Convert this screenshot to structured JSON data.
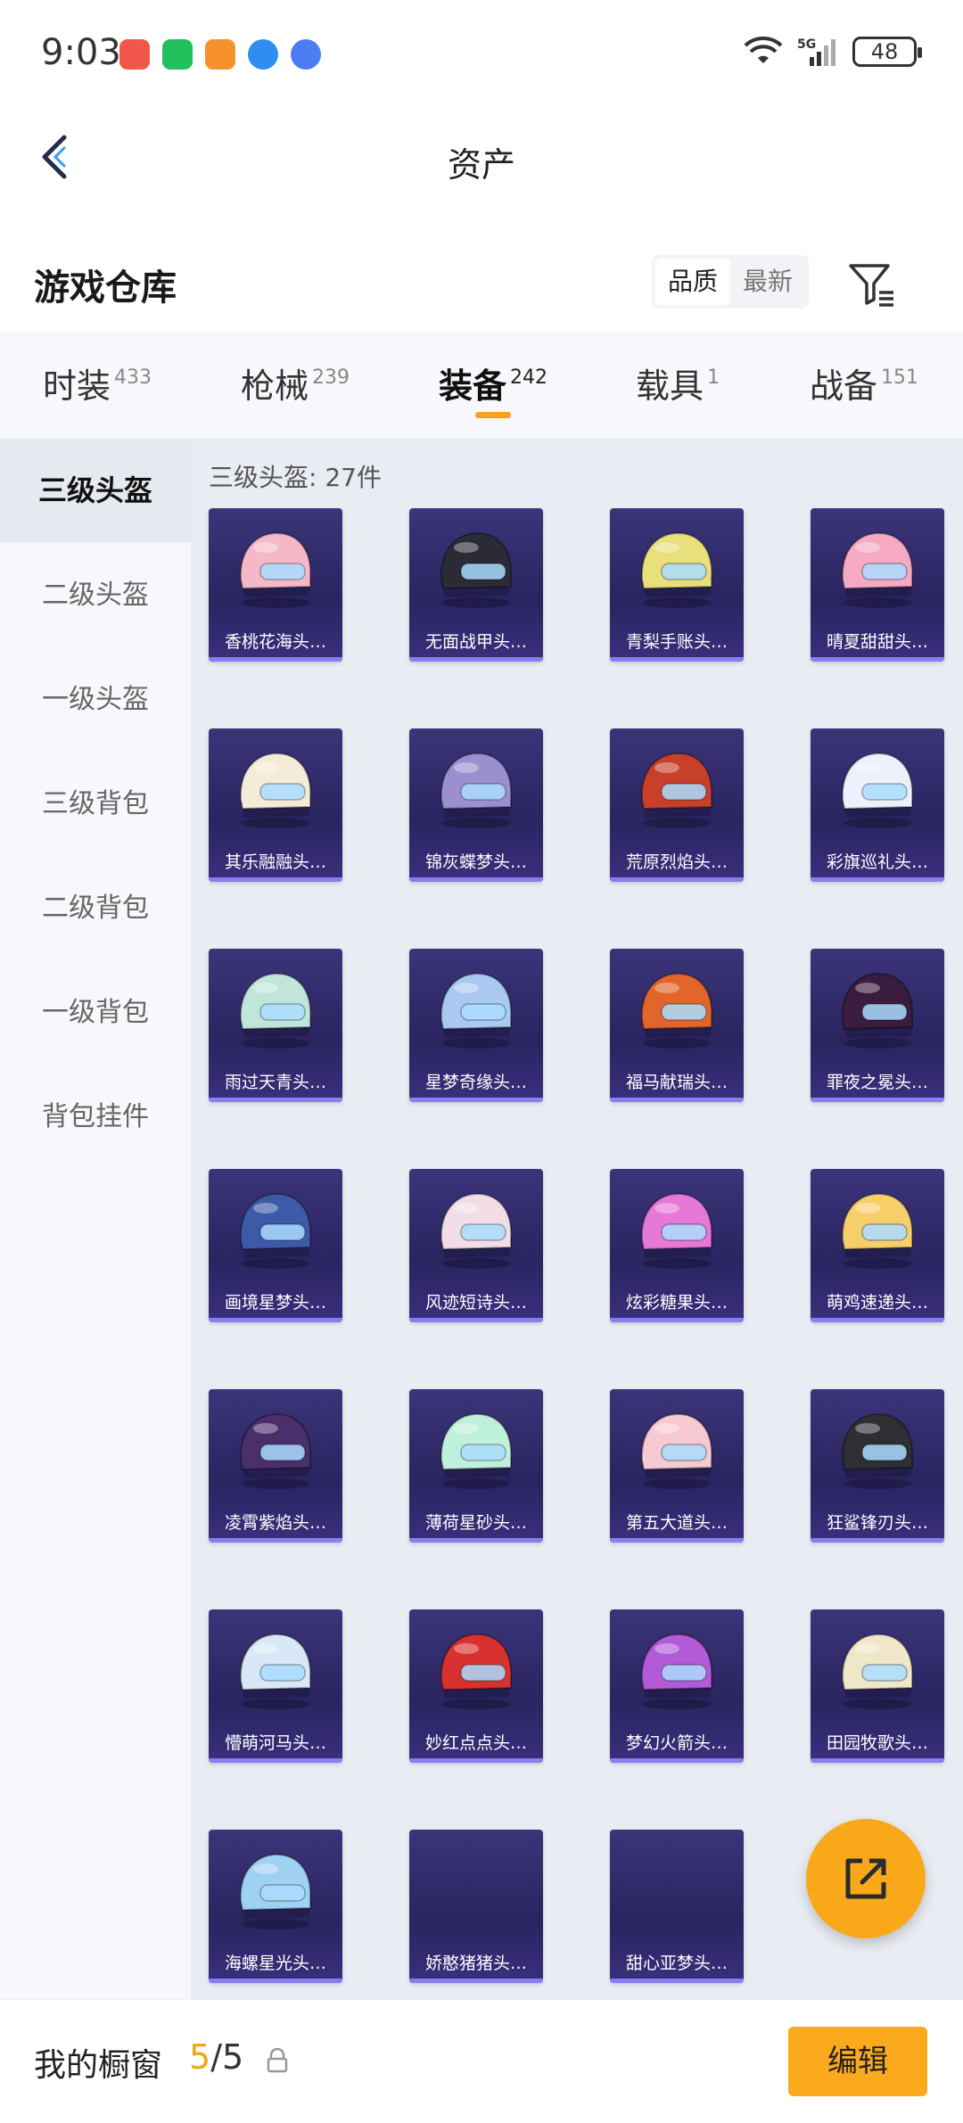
{
  "status_bar": {
    "time": "9:03",
    "battery": "48",
    "network": "5G"
  },
  "nav": {
    "title": "资产"
  },
  "warehouse": {
    "title": "游戏仓库",
    "sort_options": [
      "品质",
      "最新"
    ],
    "active_sort": "品质"
  },
  "tabs": [
    {
      "label": "时装",
      "count": "433"
    },
    {
      "label": "枪械",
      "count": "239"
    },
    {
      "label": "装备",
      "count": "242"
    },
    {
      "label": "载具",
      "count": "1"
    },
    {
      "label": "战备",
      "count": "151"
    }
  ],
  "active_tab": "装备",
  "sidebar": {
    "items": [
      {
        "label": "三级头盔"
      },
      {
        "label": "二级头盔"
      },
      {
        "label": "一级头盔"
      },
      {
        "label": "三级背包"
      },
      {
        "label": "二级背包"
      },
      {
        "label": "一级背包"
      },
      {
        "label": "背包挂件"
      }
    ],
    "active": "三级头盔"
  },
  "content": {
    "count_label": "三级头盔: 27件",
    "items": [
      {
        "name": "香桃花海头…",
        "color": "#f5b8c8"
      },
      {
        "name": "无面战甲头…",
        "color": "#2b2b36"
      },
      {
        "name": "青梨手账头…",
        "color": "#e8e07a"
      },
      {
        "name": "晴夏甜甜头…",
        "color": "#f6a9c3"
      },
      {
        "name": "其乐融融头…",
        "color": "#f4ecd6"
      },
      {
        "name": "锦灰蝶梦头…",
        "color": "#9c8fd0"
      },
      {
        "name": "荒原烈焰头…",
        "color": "#c8402a"
      },
      {
        "name": "彩旗巡礼头…",
        "color": "#eef0fb"
      },
      {
        "name": "雨过天青头…",
        "color": "#bfe6d8"
      },
      {
        "name": "星梦奇缘头…",
        "color": "#a9c9f0"
      },
      {
        "name": "福马献瑞头…",
        "color": "#e2652a"
      },
      {
        "name": "罪夜之冕头…",
        "color": "#3a1c3e"
      },
      {
        "name": "画境星梦头…",
        "color": "#3c5aa8"
      },
      {
        "name": "风迹短诗头…",
        "color": "#f2dde6"
      },
      {
        "name": "炫彩糖果头…",
        "color": "#e678d8"
      },
      {
        "name": "萌鸡速递头…",
        "color": "#f6cf6b"
      },
      {
        "name": "凌霄紫焰头…",
        "color": "#4a2f6a"
      },
      {
        "name": "薄荷星砂头…",
        "color": "#bff0dc"
      },
      {
        "name": "第五大道头…",
        "color": "#f7c9d2"
      },
      {
        "name": "狂鲨锋刃头…",
        "color": "#2e2e33"
      },
      {
        "name": "懵萌河马头…",
        "color": "#d8e8f6"
      },
      {
        "name": "妙红点点头…",
        "color": "#d8322f"
      },
      {
        "name": "梦幻火箭头…",
        "color": "#b35ad8"
      },
      {
        "name": "田园牧歌头…",
        "color": "#efe7c7"
      },
      {
        "name": "海螺星光头…",
        "color": "#9fd2f2"
      },
      {
        "name": "娇憨猪猪头…",
        "color": ""
      },
      {
        "name": "甜心亚梦头…",
        "color": ""
      }
    ]
  },
  "bottom_bar": {
    "label": "我的橱窗",
    "current": "5",
    "total": "/5",
    "edit_label": "编辑"
  },
  "colors": {
    "accent": "#f9a81a",
    "card_bg": "#2a2460"
  }
}
